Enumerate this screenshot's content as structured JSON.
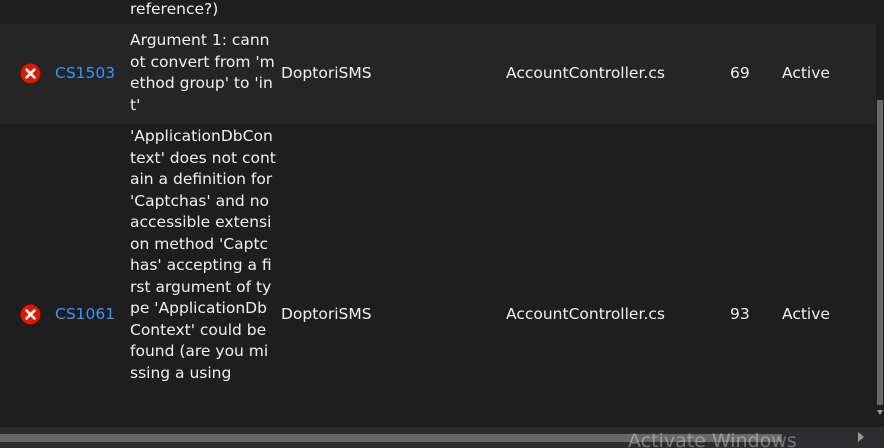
{
  "error_list": {
    "partial_row": {
      "description_tail": "reference?)"
    },
    "rows": [
      {
        "icon": "error-icon",
        "code": "CS1503",
        "description": "Argument 1: cannot convert from 'method group' to 'int'",
        "project": "DoptoriSMS",
        "file": "AccountController.cs",
        "line": "69",
        "state": "Active"
      },
      {
        "icon": "error-icon",
        "code": "CS1061",
        "description": "'ApplicationDbContext' does not contain a definition for 'Captchas' and no accessible extension method 'Captchas' accepting a first argument of type 'ApplicationDbContext' could be found (are you missing a using",
        "project": "DoptoriSMS",
        "file": "AccountController.cs",
        "line": "93",
        "state": "Active"
      }
    ]
  },
  "watermark": "Activate Windows",
  "colors": {
    "code_link": "#3794ff",
    "error_icon": "#e51400",
    "row_alt": "#252526",
    "background": "#1e1e1e"
  }
}
